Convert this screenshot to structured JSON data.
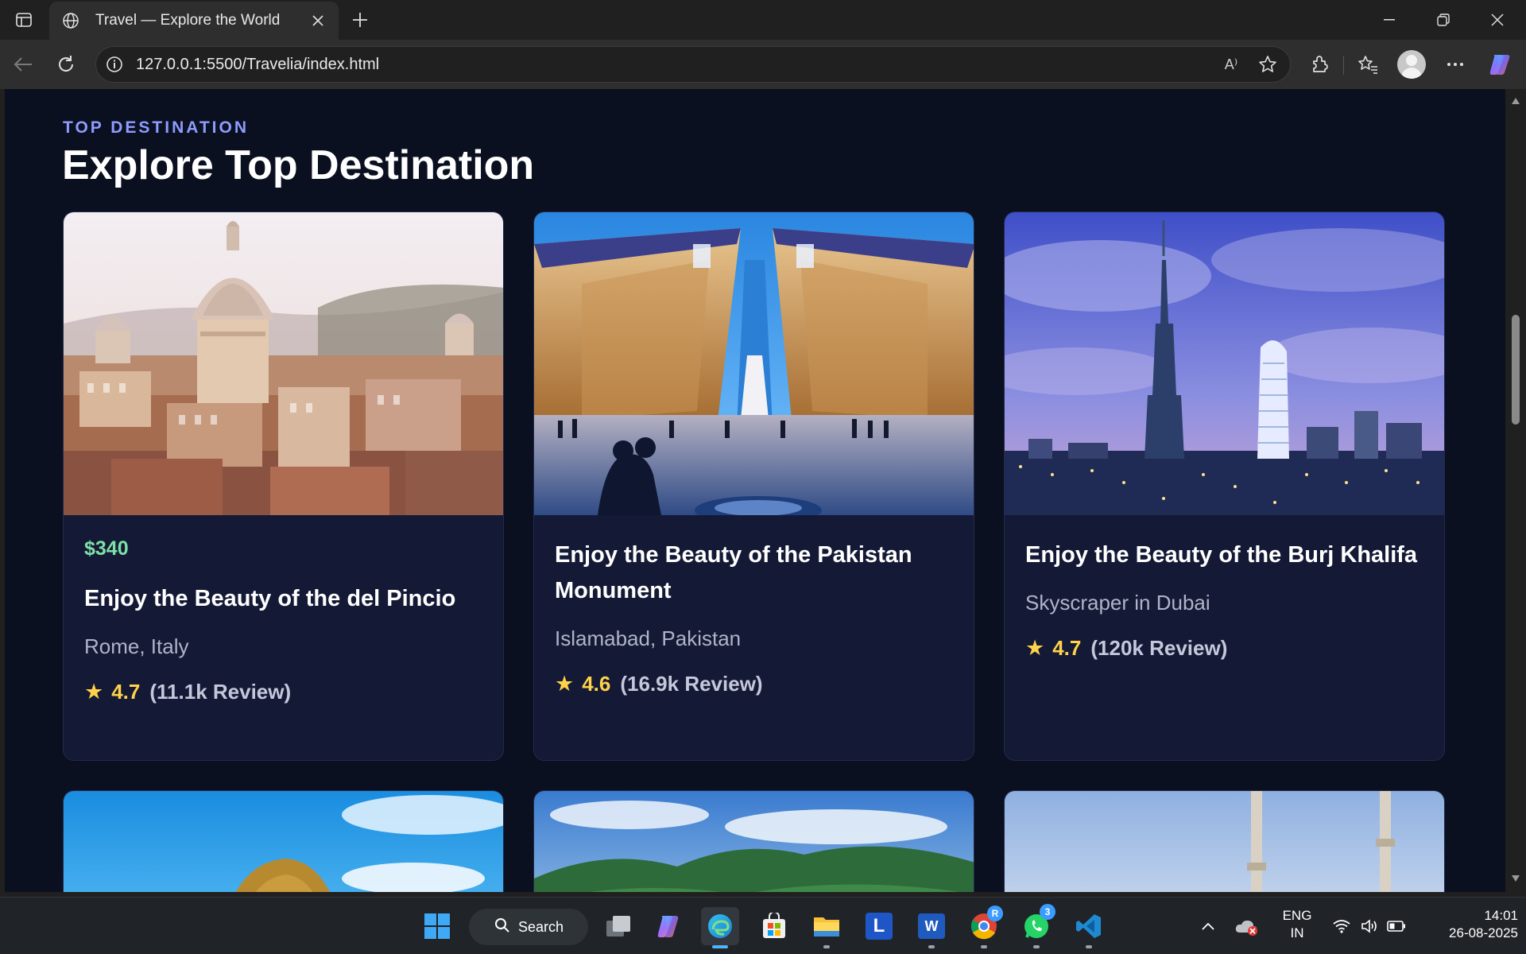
{
  "browser": {
    "tab_title": "Travel — Explore the World",
    "url": "127.0.0.1:5500/Travelia/index.html",
    "read_aloud_label": "A⁾"
  },
  "page": {
    "eyebrow": "TOP DESTINATION",
    "title": "Explore Top Destination",
    "cards": [
      {
        "price": "$340",
        "title": "Enjoy the Beauty of the del Pincio",
        "location": "Rome, Italy",
        "rating": "4.7",
        "reviews": "(11.1k Review)"
      },
      {
        "price": "",
        "title": "Enjoy the Beauty of the Pakistan Monument",
        "location": "Islamabad, Pakistan",
        "rating": "4.6",
        "reviews": "(16.9k Review)"
      },
      {
        "price": "",
        "title": "Enjoy the Beauty of the Burj Khalifa",
        "location": "Skyscraper in Dubai",
        "rating": "4.7",
        "reviews": "(120k Review)"
      }
    ],
    "star_glyph": "★"
  },
  "taskbar": {
    "search_label": "Search",
    "lang_line1": "ENG",
    "lang_line2": "IN",
    "time": "14:01",
    "date": "26-08-2025",
    "whatsapp_badge": "3",
    "chrome_badge": "R",
    "launcher_letter": "L",
    "word_letter": "W"
  },
  "colors": {
    "accent": "#8d9cff",
    "price": "#7ee0a6",
    "star": "#ffd24a",
    "page_bg": "#0b1020",
    "card_bg": "#141a36"
  }
}
